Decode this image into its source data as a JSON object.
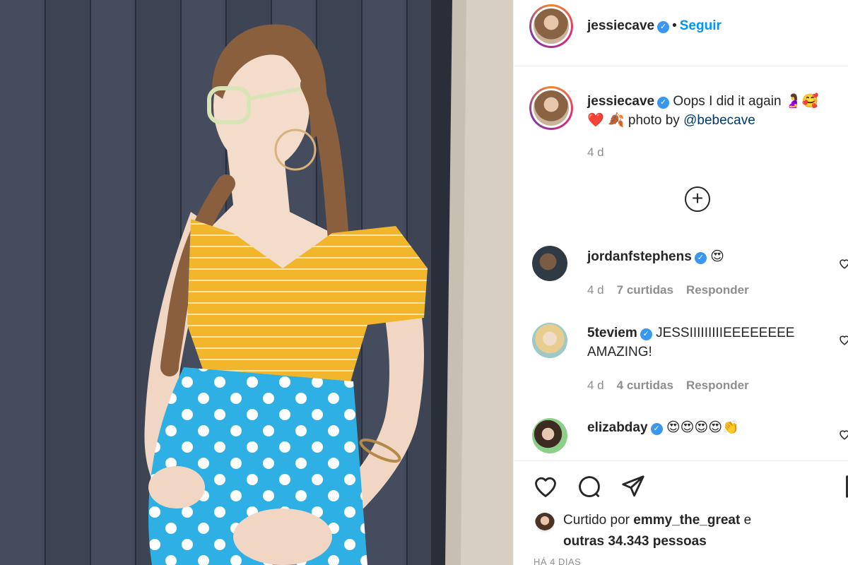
{
  "post": {
    "author": "jessiecave",
    "follow_label": "Seguir",
    "separator": "•",
    "caption_text": "Oops I did it again",
    "caption_line2_prefix": "photo by",
    "caption_mention": "@bebecave",
    "caption_time": "4 d",
    "load_more_icon": "plus-circle-icon"
  },
  "comments": [
    {
      "user": "jordanfstephens",
      "text": "😍",
      "time": "4 d",
      "likes": "7 curtidas",
      "reply": "Responder"
    },
    {
      "user": "5teviem",
      "text": "JESSIIIIIIIIIEEEEEEEE",
      "text2": "AMAZING!",
      "time": "4 d",
      "likes": "4 curtidas",
      "reply": "Responder"
    },
    {
      "user": "elizabday",
      "text": "😍😍😍😍👏",
      "time": "",
      "likes": "",
      "reply": ""
    }
  ],
  "footer": {
    "liked_prefix": "Curtido por",
    "liked_user": "emmy_the_great",
    "liked_and": "e",
    "liked_others": "outras 34.343 pessoas",
    "date": "HÁ 4 DIAS"
  },
  "colors": {
    "accent": "#0095f6",
    "verified": "#3897f0",
    "muted": "#8e8e8e"
  }
}
